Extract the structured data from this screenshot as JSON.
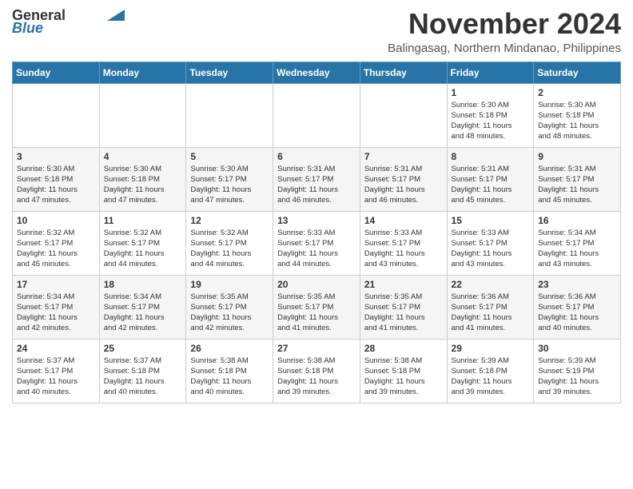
{
  "logo": {
    "general": "General",
    "blue": "Blue"
  },
  "header": {
    "month": "November 2024",
    "location": "Balingasag, Northern Mindanao, Philippines"
  },
  "weekdays": [
    "Sunday",
    "Monday",
    "Tuesday",
    "Wednesday",
    "Thursday",
    "Friday",
    "Saturday"
  ],
  "weeks": [
    [
      {
        "day": "",
        "info": ""
      },
      {
        "day": "",
        "info": ""
      },
      {
        "day": "",
        "info": ""
      },
      {
        "day": "",
        "info": ""
      },
      {
        "day": "",
        "info": ""
      },
      {
        "day": "1",
        "info": "Sunrise: 5:30 AM\nSunset: 5:18 PM\nDaylight: 11 hours\nand 48 minutes."
      },
      {
        "day": "2",
        "info": "Sunrise: 5:30 AM\nSunset: 5:18 PM\nDaylight: 11 hours\nand 48 minutes."
      }
    ],
    [
      {
        "day": "3",
        "info": "Sunrise: 5:30 AM\nSunset: 5:18 PM\nDaylight: 11 hours\nand 47 minutes."
      },
      {
        "day": "4",
        "info": "Sunrise: 5:30 AM\nSunset: 5:18 PM\nDaylight: 11 hours\nand 47 minutes."
      },
      {
        "day": "5",
        "info": "Sunrise: 5:30 AM\nSunset: 5:17 PM\nDaylight: 11 hours\nand 47 minutes."
      },
      {
        "day": "6",
        "info": "Sunrise: 5:31 AM\nSunset: 5:17 PM\nDaylight: 11 hours\nand 46 minutes."
      },
      {
        "day": "7",
        "info": "Sunrise: 5:31 AM\nSunset: 5:17 PM\nDaylight: 11 hours\nand 46 minutes."
      },
      {
        "day": "8",
        "info": "Sunrise: 5:31 AM\nSunset: 5:17 PM\nDaylight: 11 hours\nand 45 minutes."
      },
      {
        "day": "9",
        "info": "Sunrise: 5:31 AM\nSunset: 5:17 PM\nDaylight: 11 hours\nand 45 minutes."
      }
    ],
    [
      {
        "day": "10",
        "info": "Sunrise: 5:32 AM\nSunset: 5:17 PM\nDaylight: 11 hours\nand 45 minutes."
      },
      {
        "day": "11",
        "info": "Sunrise: 5:32 AM\nSunset: 5:17 PM\nDaylight: 11 hours\nand 44 minutes."
      },
      {
        "day": "12",
        "info": "Sunrise: 5:32 AM\nSunset: 5:17 PM\nDaylight: 11 hours\nand 44 minutes."
      },
      {
        "day": "13",
        "info": "Sunrise: 5:33 AM\nSunset: 5:17 PM\nDaylight: 11 hours\nand 44 minutes."
      },
      {
        "day": "14",
        "info": "Sunrise: 5:33 AM\nSunset: 5:17 PM\nDaylight: 11 hours\nand 43 minutes."
      },
      {
        "day": "15",
        "info": "Sunrise: 5:33 AM\nSunset: 5:17 PM\nDaylight: 11 hours\nand 43 minutes."
      },
      {
        "day": "16",
        "info": "Sunrise: 5:34 AM\nSunset: 5:17 PM\nDaylight: 11 hours\nand 43 minutes."
      }
    ],
    [
      {
        "day": "17",
        "info": "Sunrise: 5:34 AM\nSunset: 5:17 PM\nDaylight: 11 hours\nand 42 minutes."
      },
      {
        "day": "18",
        "info": "Sunrise: 5:34 AM\nSunset: 5:17 PM\nDaylight: 11 hours\nand 42 minutes."
      },
      {
        "day": "19",
        "info": "Sunrise: 5:35 AM\nSunset: 5:17 PM\nDaylight: 11 hours\nand 42 minutes."
      },
      {
        "day": "20",
        "info": "Sunrise: 5:35 AM\nSunset: 5:17 PM\nDaylight: 11 hours\nand 41 minutes."
      },
      {
        "day": "21",
        "info": "Sunrise: 5:35 AM\nSunset: 5:17 PM\nDaylight: 11 hours\nand 41 minutes."
      },
      {
        "day": "22",
        "info": "Sunrise: 5:36 AM\nSunset: 5:17 PM\nDaylight: 11 hours\nand 41 minutes."
      },
      {
        "day": "23",
        "info": "Sunrise: 5:36 AM\nSunset: 5:17 PM\nDaylight: 11 hours\nand 40 minutes."
      }
    ],
    [
      {
        "day": "24",
        "info": "Sunrise: 5:37 AM\nSunset: 5:17 PM\nDaylight: 11 hours\nand 40 minutes."
      },
      {
        "day": "25",
        "info": "Sunrise: 5:37 AM\nSunset: 5:18 PM\nDaylight: 11 hours\nand 40 minutes."
      },
      {
        "day": "26",
        "info": "Sunrise: 5:38 AM\nSunset: 5:18 PM\nDaylight: 11 hours\nand 40 minutes."
      },
      {
        "day": "27",
        "info": "Sunrise: 5:38 AM\nSunset: 5:18 PM\nDaylight: 11 hours\nand 39 minutes."
      },
      {
        "day": "28",
        "info": "Sunrise: 5:38 AM\nSunset: 5:18 PM\nDaylight: 11 hours\nand 39 minutes."
      },
      {
        "day": "29",
        "info": "Sunrise: 5:39 AM\nSunset: 5:18 PM\nDaylight: 11 hours\nand 39 minutes."
      },
      {
        "day": "30",
        "info": "Sunrise: 5:39 AM\nSunset: 5:19 PM\nDaylight: 11 hours\nand 39 minutes."
      }
    ]
  ]
}
